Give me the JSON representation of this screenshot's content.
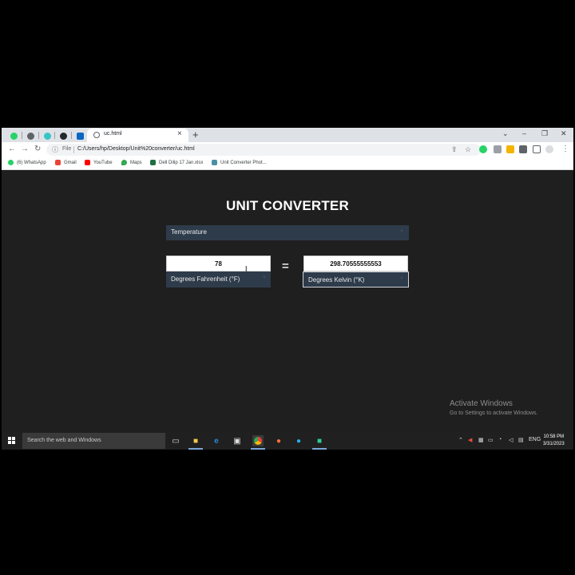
{
  "browser": {
    "active_tab_title": "uc.html",
    "new_tab_glyph": "+",
    "url_prefix": "File",
    "url": "C:/Users/hp/Desktop/Unit%20converter/uc.html",
    "window_controls": [
      "⌄",
      "–",
      "❐",
      "✕"
    ]
  },
  "bookmarks": [
    {
      "label": "(6) WhatsApp",
      "color": "#25d366"
    },
    {
      "label": "Gmail",
      "color": "#ea4335"
    },
    {
      "label": "YouTube",
      "color": "#ff0000"
    },
    {
      "label": "Maps",
      "color": "#34a853"
    },
    {
      "label": "Dell Dilip 17 Jan.xlsx",
      "color": "#1d6f42"
    },
    {
      "label": "Unit Converter Phot...",
      "color": "#4a90a4"
    }
  ],
  "app": {
    "title": "UNIT CONVERTER",
    "category": "Temperature",
    "equals": "=",
    "from_value": "78",
    "from_unit": "Degrees Fahrenheit (°F)",
    "to_value": "298.70555555553",
    "to_unit": "Degrees Kelvin (°K)"
  },
  "watermark": {
    "heading": "Activate Windows",
    "subtext": "Go to Settings to activate Windows."
  },
  "taskbar": {
    "search_placeholder": "Search the web and Windows",
    "language": "ENG",
    "time": "10:58 PM",
    "date": "3/31/2023"
  }
}
